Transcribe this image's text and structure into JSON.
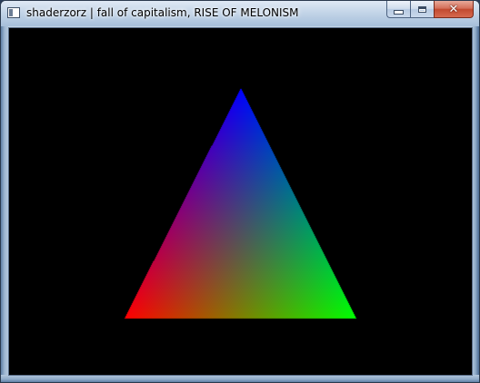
{
  "window": {
    "title": "shaderzorz | fall of capitalism, RISE OF MELONISM",
    "icon": "app-window-icon",
    "controls": {
      "minimize_icon": "minimize-icon",
      "maximize_icon": "maximize-icon",
      "close_icon": "close-icon",
      "close_glyph": "✕"
    },
    "frame_color": "#a9c0d8",
    "close_button_color": "#c24a30"
  },
  "viewport": {
    "background_color": "#000000",
    "triangle": {
      "vertices": [
        {
          "name": "top",
          "color": "#0000ff"
        },
        {
          "name": "bottom-left",
          "color": "#ff0000"
        },
        {
          "name": "bottom-right",
          "color": "#00ff00"
        }
      ]
    }
  }
}
